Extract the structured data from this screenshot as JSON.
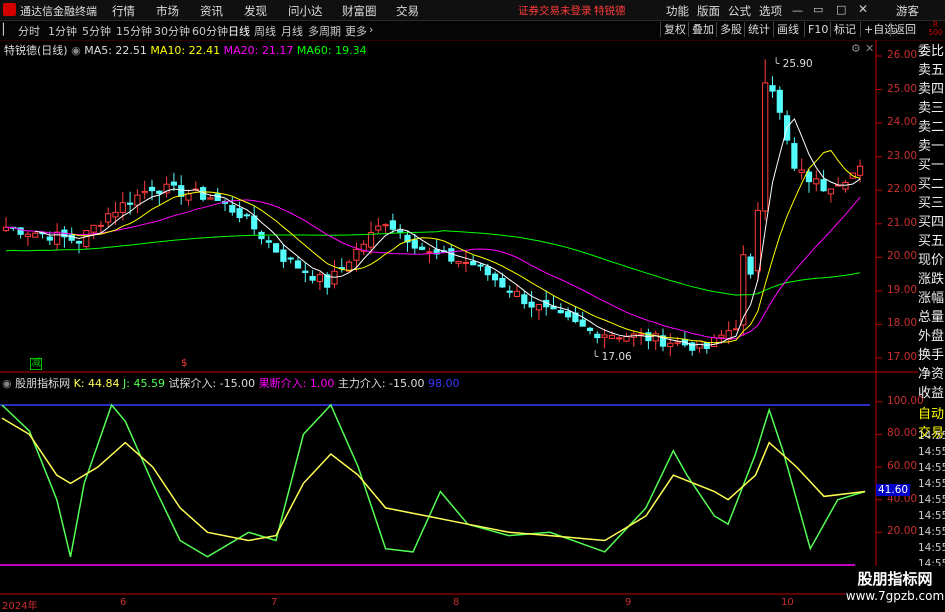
{
  "app": {
    "name": "通达信金融终端"
  },
  "menu": [
    "行情",
    "市场",
    "资讯",
    "发现",
    "问小达",
    "财富圈",
    "交易"
  ],
  "alert": {
    "text": "证券交易未登录",
    "stock": "特锐德"
  },
  "right_menu": [
    "功能",
    "版面",
    "公式",
    "选项"
  ],
  "guest": "游客",
  "periods": [
    "分时",
    "1分钟",
    "5分钟",
    "15分钟",
    "30分钟",
    "60分钟",
    "日线",
    "周线",
    "月线",
    "多周期",
    "更多"
  ],
  "active_period": "日线",
  "toolbar_right": [
    "复权",
    "叠加",
    "多股",
    "统计",
    "画线",
    "F10",
    "标记",
    "+自选",
    "返回"
  ],
  "r500": "R\n500",
  "main_legend": {
    "title": "特锐德(日线)",
    "ma5": "MA5: 22.51",
    "ma10": "MA10: 22.41",
    "ma20": "MA20: 21.17",
    "ma60": "MA60: 19.34"
  },
  "price_axis": [
    "26.00",
    "25.00",
    "24.00",
    "23.00",
    "22.00",
    "21.00",
    "20.00",
    "19.00",
    "18.00",
    "17.00"
  ],
  "high_label": "25.90",
  "low_label": "17.06",
  "side_panel": [
    "委比",
    "卖五",
    "卖四",
    "卖三",
    "卖二",
    "卖一",
    "买一",
    "买二",
    "买三",
    "买四",
    "买五",
    "现价",
    "涨跌",
    "涨幅",
    "总量",
    "外盘",
    "换手",
    "净资",
    "收益"
  ],
  "side_panel2": [
    "自动",
    "交易"
  ],
  "osc_legend": {
    "name": "股朋指标网",
    "k": "K: 44.84",
    "j": "J: 45.59",
    "t1": "试探介入: -15.00",
    "t2": "果断介入: 1.00",
    "t3": "主力介入: -15.00",
    "t4": "98.00"
  },
  "osc_axis": [
    "100.00",
    "80.00",
    "60.00",
    "40.00",
    "20.00"
  ],
  "osc_value": "41.60",
  "time_labels": [
    "14:55",
    "14:55",
    "14:55",
    "14:55",
    "14:55",
    "14:55",
    "14:55",
    "14:55",
    "14:55",
    "14:55"
  ],
  "dates": [
    "2024年",
    "6",
    "7",
    "8",
    "9",
    "10"
  ],
  "markers": {
    "jian": "减",
    "s": "$"
  },
  "watermark": {
    "line1": "股朋指标网",
    "line2": "www.7gpzb.com"
  },
  "colors": {
    "up": "#ff3c3c",
    "down": "#54fcfc",
    "ma5": "#ffffff",
    "ma10": "#ffff00",
    "ma20": "#ff00ff",
    "ma60": "#00ff00",
    "axis_red": "#c00000",
    "k": "#ffff54",
    "j": "#54ff54"
  },
  "chart_data": [
    {
      "type": "candlestick",
      "title": "特锐德(日线)",
      "ylim": [
        17.0,
        26.0
      ],
      "high": 25.9,
      "low": 17.06,
      "ma_latest": {
        "MA5": 22.51,
        "MA10": 22.41,
        "MA20": 21.17,
        "MA60": 19.34
      }
    },
    {
      "type": "line",
      "title": "股朋指标网",
      "ylim": [
        0,
        100
      ],
      "series": [
        {
          "name": "K",
          "latest": 44.84
        },
        {
          "name": "J",
          "latest": 45.59
        }
      ],
      "levels": [
        98.0,
        0.0
      ]
    }
  ]
}
